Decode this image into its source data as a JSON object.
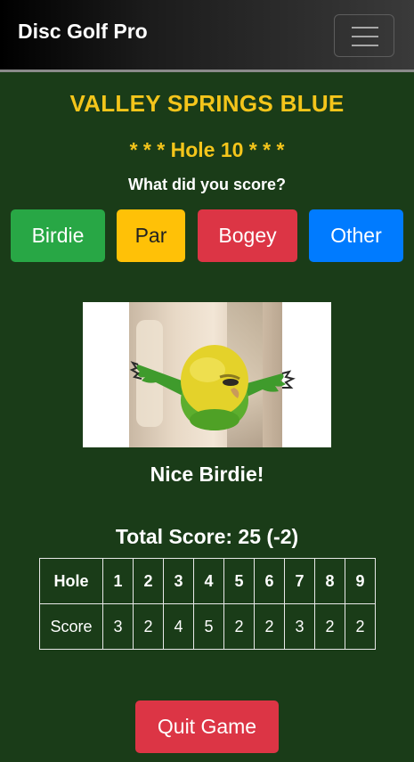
{
  "navbar": {
    "brand": "Disc Golf Pro",
    "menu_icon": "hamburger-menu-icon"
  },
  "course": {
    "name": "VALLEY SPRINGS BLUE"
  },
  "hole": {
    "title": "* * * Hole 10 * * *",
    "prompt": "What did you score?"
  },
  "score_buttons": {
    "birdie": "Birdie",
    "par": "Par",
    "bogey": "Bogey",
    "other": "Other"
  },
  "result": {
    "image_description": "budgie",
    "caption": "Nice Birdie!"
  },
  "total": {
    "text": "Total Score: 25 (-2)"
  },
  "scorecard": {
    "hole_header": "Hole",
    "score_header": "Score",
    "holes": [
      "1",
      "2",
      "3",
      "4",
      "5",
      "6",
      "7",
      "8",
      "9"
    ],
    "scores": [
      "3",
      "2",
      "4",
      "5",
      "2",
      "2",
      "3",
      "2",
      "2"
    ]
  },
  "actions": {
    "quit": "Quit Game"
  },
  "colors": {
    "background": "#1a3c18",
    "heading": "#f4c51b",
    "birdie": "#28a745",
    "par": "#ffc107",
    "bogey": "#dc3545",
    "other": "#007bff"
  }
}
